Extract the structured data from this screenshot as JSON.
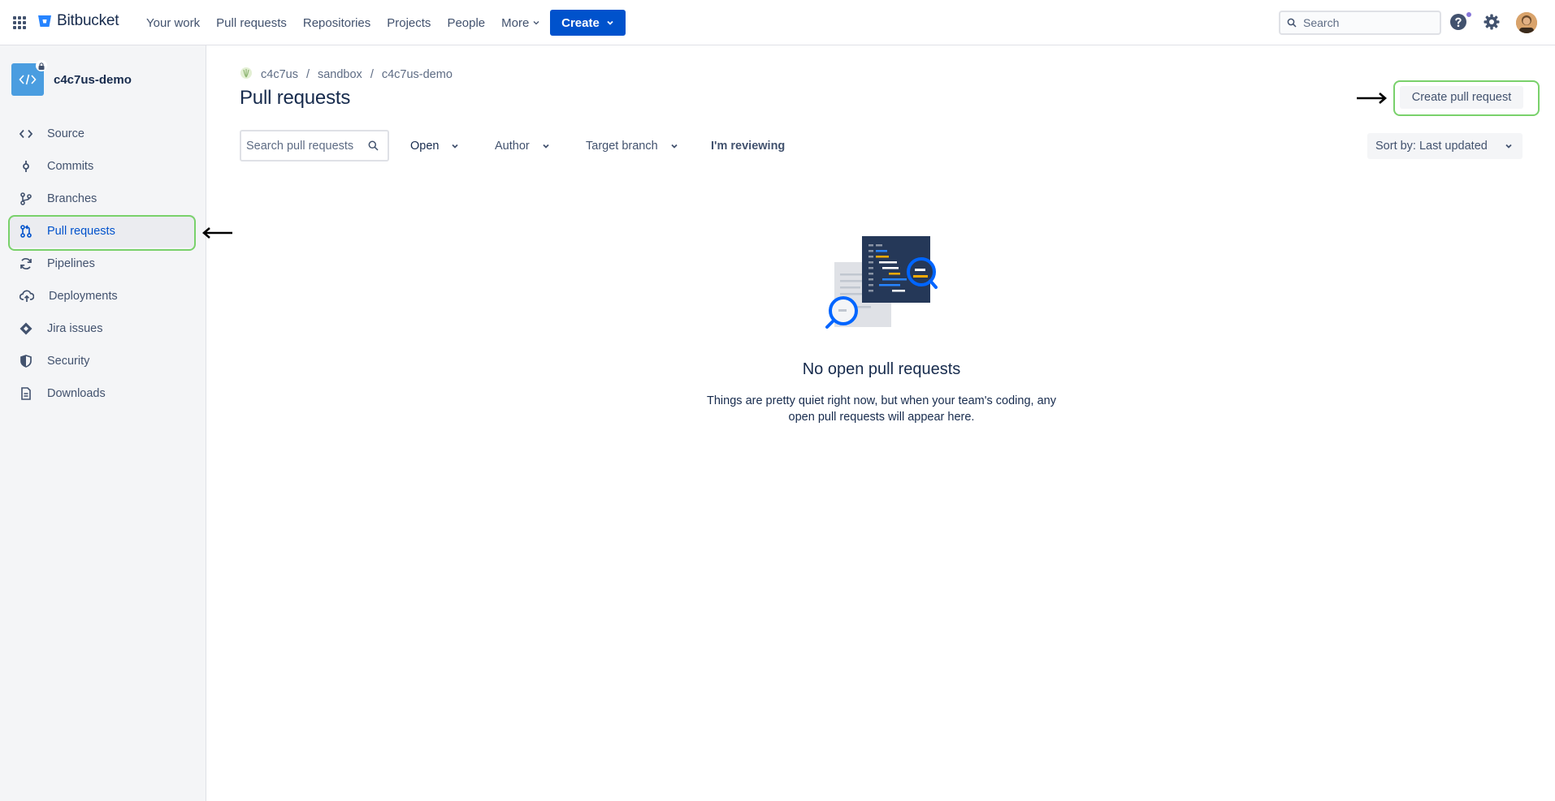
{
  "topnav": {
    "brand": "Bitbucket",
    "links": [
      "Your work",
      "Pull requests",
      "Repositories",
      "Projects",
      "People"
    ],
    "more_label": "More",
    "create_label": "Create",
    "search_placeholder": "Search"
  },
  "sidebar": {
    "repo_name": "c4c7us-demo",
    "items": [
      {
        "label": "Source",
        "icon": "code-icon"
      },
      {
        "label": "Commits",
        "icon": "commit-icon"
      },
      {
        "label": "Branches",
        "icon": "branch-icon"
      },
      {
        "label": "Pull requests",
        "icon": "pull-request-icon",
        "active": true
      },
      {
        "label": "Pipelines",
        "icon": "pipelines-icon"
      },
      {
        "label": "Deployments",
        "icon": "cloud-upload-icon"
      },
      {
        "label": "Jira issues",
        "icon": "jira-icon"
      },
      {
        "label": "Security",
        "icon": "shield-icon"
      },
      {
        "label": "Downloads",
        "icon": "document-icon"
      }
    ]
  },
  "breadcrumb": [
    "c4c7us",
    "sandbox",
    "c4c7us-demo"
  ],
  "page": {
    "title": "Pull requests",
    "create_pr_label": "Create pull request"
  },
  "filters": {
    "search_placeholder": "Search pull requests",
    "state": "Open",
    "author": "Author",
    "target_branch": "Target branch",
    "reviewing": "I'm reviewing",
    "sort": "Sort by: Last updated"
  },
  "empty_state": {
    "title": "No open pull requests",
    "body": "Things are pretty quiet right now, but when your team's coding, any open pull requests will appear here."
  },
  "colors": {
    "primary": "#0052cc",
    "highlight": "#79d16b",
    "text": "#172b4d",
    "subtle": "#42526e"
  }
}
